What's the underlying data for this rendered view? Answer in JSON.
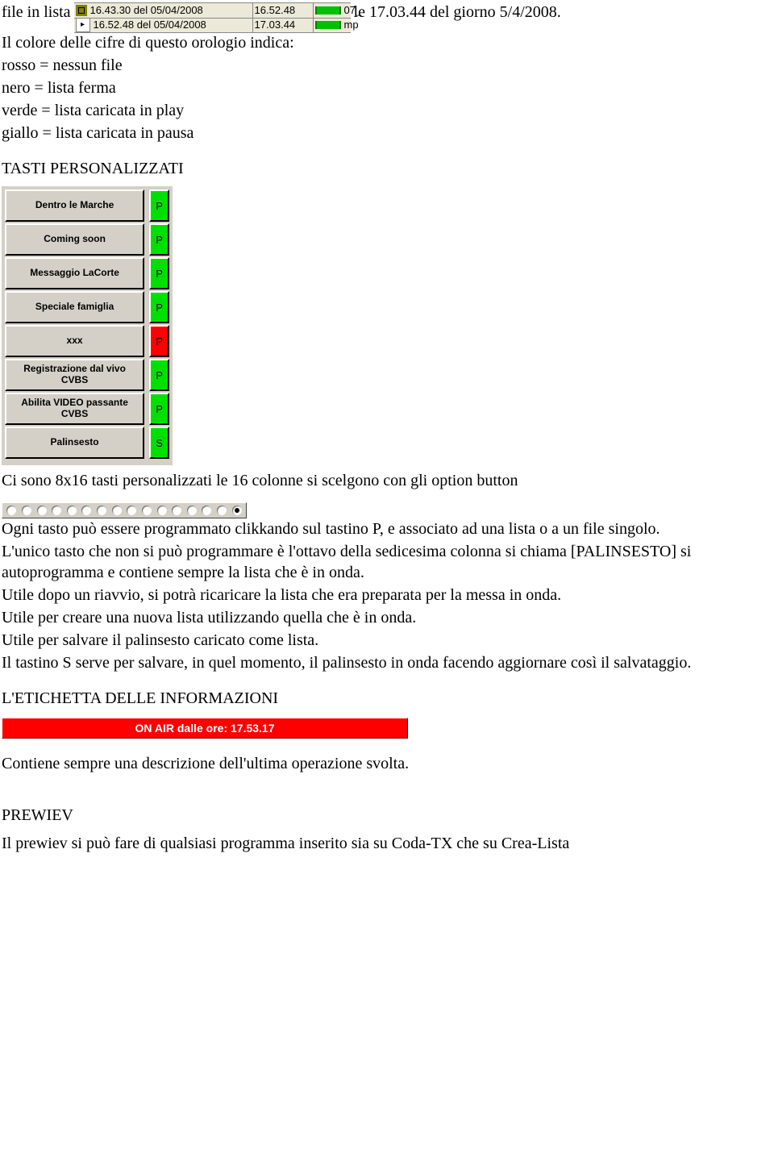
{
  "log": {
    "rows": [
      {
        "col1": "16.43.30 del 05/04/2008",
        "col2": "16.52.48",
        "col3": "07_"
      },
      {
        "col1": "16.52.48 del 05/04/2008",
        "col2": "17.03.44",
        "col3": "mp"
      }
    ]
  },
  "intro": {
    "prefix": "file in lista",
    "suffix": "le 17.03.44 del giorno 5/4/2008.",
    "line2": "Il colore delle cifre di questo orologio indica:"
  },
  "legend": {
    "rosso": "rosso = nessun file",
    "nero": "nero = lista ferma",
    "verde": "verde = lista caricata in play",
    "giallo": "giallo = lista caricata in pausa"
  },
  "headings": {
    "tasti": "TASTI PERSONALIZZATI",
    "etichetta": "L'ETICHETTA DELLE INFORMAZIONI",
    "prewiev": "PREWIEV"
  },
  "buttons": {
    "items": [
      {
        "label": "Dentro le Marche",
        "ind": "P",
        "color": "green"
      },
      {
        "label": "Coming soon",
        "ind": "P",
        "color": "green"
      },
      {
        "label": "Messaggio LaCorte",
        "ind": "P",
        "color": "green"
      },
      {
        "label": "Speciale famiglia",
        "ind": "P",
        "color": "green"
      },
      {
        "label": "xxx",
        "ind": "P",
        "color": "red"
      },
      {
        "label": "Registrazione dal vivo CVBS",
        "ind": "P",
        "color": "green"
      },
      {
        "label": "Abilita VIDEO passante CVBS",
        "ind": "P",
        "color": "green"
      },
      {
        "label": "Palinsesto",
        "ind": "S",
        "color": "green"
      }
    ]
  },
  "radios": {
    "count": 16,
    "selected_index": 15
  },
  "para_tasti": {
    "p1": "Ci sono 8x16 tasti personalizzati le 16 colonne si scelgono con gli option button",
    "p2a": "Ogni tasto può essere programmato clikkando sul tastino P, e associato ad una lista o a un file singolo.",
    "p2b": "L'unico tasto che non si può programmare è l'ottavo della sedicesima colonna si chiama [PALINSESTO] si autoprogramma e contiene sempre la lista che è in onda.",
    "p2c": "Utile dopo un riavvio, si potrà ricaricare la lista che era preparata per la messa in onda.",
    "p2d": "Utile per creare una nuova lista utilizzando quella che è in onda.",
    "p2e": "Utile per salvare il palinsesto caricato come lista.",
    "p2f": "Il tastino S serve per salvare, in quel momento, il palinsesto in onda facendo aggiornare così il salvataggio."
  },
  "onair": {
    "text": "ON AIR dalle ore: 17.53.17"
  },
  "para_etichetta": "Contiene sempre una descrizione dell'ultima operazione svolta.",
  "para_prewiev": "Il prewiev si può fare di qualsiasi programma inserito sia su Coda-TX che su Crea-Lista"
}
